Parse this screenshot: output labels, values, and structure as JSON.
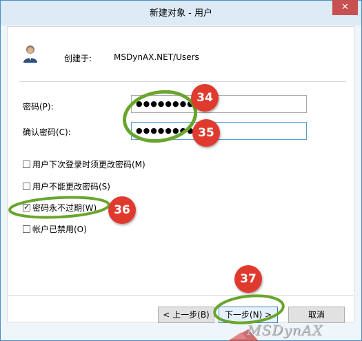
{
  "window": {
    "title": "新建对象 - 用户",
    "close_glyph": "✕"
  },
  "header": {
    "created_in_label": "创建于:",
    "path": "MSDynAX.NET/Users",
    "icon": "user-icon"
  },
  "fields": {
    "password": {
      "label": "密码(P):",
      "value": "●●●●●●●●"
    },
    "confirm": {
      "label": "确认密码(C):",
      "value": "●●●●●●●●"
    }
  },
  "options": [
    {
      "label": "用户下次登录时须更改密码(M)",
      "checked": false
    },
    {
      "label": "用户不能更改密码(S)",
      "checked": false
    },
    {
      "label": "密码永不过期(W)",
      "checked": true
    },
    {
      "label": "帐户已禁用(O)",
      "checked": false
    }
  ],
  "buttons": {
    "back": "< 上一步(B)",
    "next": "下一步(N) >",
    "cancel": "取消"
  },
  "callouts": [
    "34",
    "35",
    "36",
    "37"
  ],
  "watermark": "MSDynAX",
  "colors": {
    "highlight": "#6aa52e",
    "callout": "#e03a2f",
    "close": "#c75050"
  }
}
